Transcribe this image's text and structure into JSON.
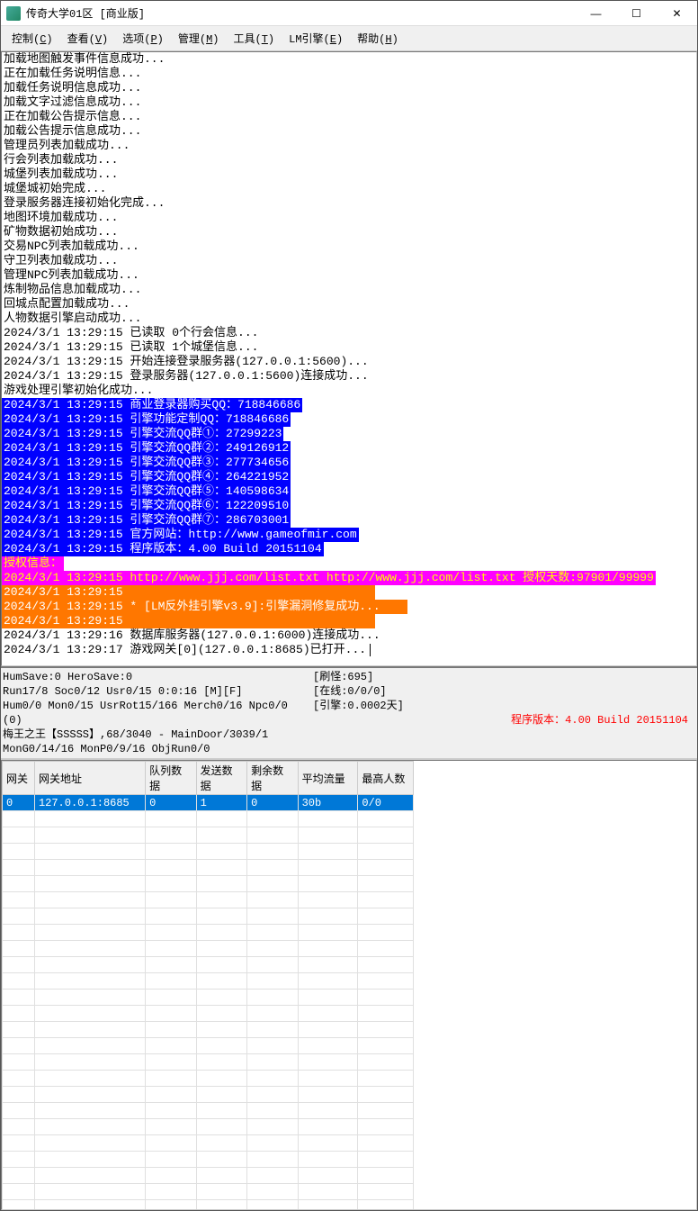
{
  "window": {
    "title": "传奇大学01区 [商业版]"
  },
  "menu": {
    "items": [
      {
        "label": "控制",
        "key": "C"
      },
      {
        "label": "查看",
        "key": "V"
      },
      {
        "label": "选项",
        "key": "P"
      },
      {
        "label": "管理",
        "key": "M"
      },
      {
        "label": "工具",
        "key": "T"
      },
      {
        "label": "LM引擎",
        "key": "E"
      },
      {
        "label": "帮助",
        "key": "H"
      }
    ]
  },
  "log": {
    "plain": [
      "加载地图触发事件信息成功...",
      "正在加载任务说明信息...",
      "加载任务说明信息成功...",
      "加载文字过滤信息成功...",
      "正在加载公告提示信息...",
      "加载公告提示信息成功...",
      "管理员列表加载成功...",
      "行会列表加载成功...",
      "城堡列表加载成功...",
      "城堡城初始完成...",
      "登录服务器连接初始化完成...",
      "地图环境加载成功...",
      "矿物数据初始成功...",
      "交易NPC列表加载成功...",
      "守卫列表加载成功...",
      "管理NPC列表加载成功...",
      "炼制物品信息加载成功...",
      "回城点配置加载成功...",
      "人物数据引擎启动成功...",
      "2024/3/1 13:29:15 已读取 0个行会信息...",
      "2024/3/1 13:29:15 已读取 1个城堡信息...",
      "2024/3/1 13:29:15 开始连接登录服务器(127.0.0.1:5600)...",
      "2024/3/1 13:29:15 登录服务器(127.0.0.1:5600)连接成功...",
      "游戏处理引擎初始化成功..."
    ],
    "blue": [
      "2024/3/1 13:29:15 商业登录器购买QQ：718846686",
      "2024/3/1 13:29:15 引擎功能定制QQ：718846686",
      "2024/3/1 13:29:15 引擎交流QQ群①：27299223",
      "2024/3/1 13:29:15 引擎交流QQ群②：249126912",
      "2024/3/1 13:29:15 引擎交流QQ群③：277734656",
      "2024/3/1 13:29:15 引擎交流QQ群④：264221952",
      "2024/3/1 13:29:15 引擎交流QQ群⑤：140598634",
      "2024/3/1 13:29:15 引擎交流QQ群⑥：122209510",
      "2024/3/1 13:29:15 引擎交流QQ群⑦：286703001",
      "2024/3/1 13:29:15 官方网站：http://www.gameofmir.com",
      "2024/3/1 13:29:15 程序版本：4.00 Build 20151104"
    ],
    "magenta_label": "授权信息：",
    "magenta_line": "2024/3/1 13:29:15 http://www.jjj.com/list.txt http://www.jjj.com/list.txt 授权天数:97901/99999",
    "orange": [
      "2024/3/1 13:29:15",
      "2024/3/1 13:29:15 * [LM反外挂引擎v3.9]:引擎漏洞修复成功...",
      "2024/3/1 13:29:15"
    ],
    "tail": [
      "2024/3/1 13:29:16 数据库服务器(127.0.0.1:6000)连接成功...",
      "2024/3/1 13:29:17 游戏网关[0](127.0.0.1:8685)已打开..."
    ]
  },
  "status": {
    "left": [
      "HumSave:0 HeroSave:0",
      "Run17/8 Soc0/12 Usr0/15          0:0:16 [M][F]",
      "Hum0/0 Mon0/15 UsrRot15/166 Merch0/16 Npc0/0 (0)",
      "梅王之王【SSSSS】,68/3040 - MainDoor/3039/1",
      "MonG0/14/16 MonP0/9/16 ObjRun0/0"
    ],
    "right": [
      "[刷怪:695]",
      "[在线:0/0/0]",
      "[引擎:0.0002天]"
    ],
    "version": "程序版本：4.00 Build 20151104"
  },
  "table": {
    "headers": [
      "网关",
      "网关地址",
      "队列数据",
      "发送数据",
      "剩余数据",
      "平均流量",
      "最高人数"
    ],
    "rows": [
      {
        "gw": "0",
        "addr": "127.0.0.1:8685",
        "queue": "0",
        "send": "1",
        "remain": "0",
        "avg": "30b",
        "max": "0/0"
      }
    ]
  }
}
